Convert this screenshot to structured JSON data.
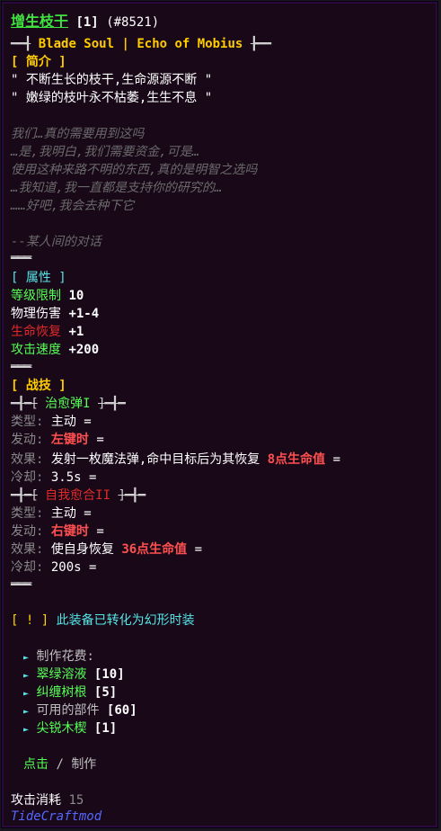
{
  "header": {
    "name": "增生枝干",
    "level": "[1]",
    "id": "(#8521)"
  },
  "origin": {
    "left_deco": "━━┫",
    "mod": "Blade Soul",
    "bar": "|",
    "item": "Echo of Mobius",
    "right_deco": "┣━━"
  },
  "intro": {
    "header": "[ 简介 ]",
    "quote1": "\" 不断生长的枝干,生命源源不断 \"",
    "quote2": "\" 嫩绿的枝叶永不枯萎,生生不息 \"",
    "dialog": [
      "我们…真的需要用到这吗",
      "…是,我明白,我们需要资金,可是…",
      "使用这种来路不明的东西,真的是明智之选吗",
      "…我知道,我一直都是支持你的研究的…",
      "……好吧,我会去种下它"
    ],
    "signature": "--某人间的对话"
  },
  "divider": "═══",
  "attributes": {
    "header": "[ 属性 ]",
    "rows": [
      {
        "label": "等级限制",
        "value": "10"
      },
      {
        "label": "物理伤害",
        "value": "+1-4"
      },
      {
        "label": "生命恢复",
        "value": "+1"
      },
      {
        "label": "攻击速度",
        "value": "+200"
      }
    ]
  },
  "skills": {
    "header": "[ 战技 ]",
    "deco_left": "━┫━[",
    "deco_right": "]━┫━",
    "items": [
      {
        "name": "治愈弹I",
        "type_label": "类型:",
        "type_value": "主动 =",
        "trigger_label": "发动:",
        "trigger_value": "左键时",
        "trigger_suffix": "=",
        "effect_label": "效果:",
        "effect_text": "发射一枚魔法弹,命中目标后为其恢复",
        "effect_highlight": "8点生命值",
        "effect_suffix": "=",
        "cooldown_label": "冷却:",
        "cooldown_value": "3.5s =",
        "eq_prefix": "="
      },
      {
        "name": "自我愈合II",
        "type_label": "类型:",
        "type_value": "主动 =",
        "trigger_label": "发动:",
        "trigger_value": "右键时",
        "trigger_suffix": "=",
        "effect_label": "效果:",
        "effect_text": "使自身恢复",
        "effect_highlight": "36点生命值",
        "effect_suffix": "=",
        "cooldown_label": "冷却:",
        "cooldown_value": "200s =",
        "eq_prefix": "="
      }
    ]
  },
  "notice": {
    "tag": "[ ! ]",
    "text": "此装备已转化为幻形时装"
  },
  "craft": {
    "arrow": "►",
    "cost_label": "制作花费:",
    "materials": [
      {
        "name": "翠绿溶液",
        "qty": "[10]",
        "color": "#55ff55"
      },
      {
        "name": "纠缠树根",
        "qty": "[5]",
        "color": "#55ff55"
      },
      {
        "name": "可用的部件",
        "qty": "[60]",
        "color": "#bfbfbf"
      },
      {
        "name": "尖锐木楔",
        "qty": "[1]",
        "color": "#55ff55"
      }
    ],
    "action_click": "点击",
    "action_sep": "/",
    "action_make": "制作"
  },
  "footer": {
    "attack_cost_label": "攻击消耗",
    "attack_cost_value": "15",
    "mod_name": "TideCraftmod"
  },
  "colors": {
    "background": "#180818",
    "border": "#2a0a3e"
  }
}
